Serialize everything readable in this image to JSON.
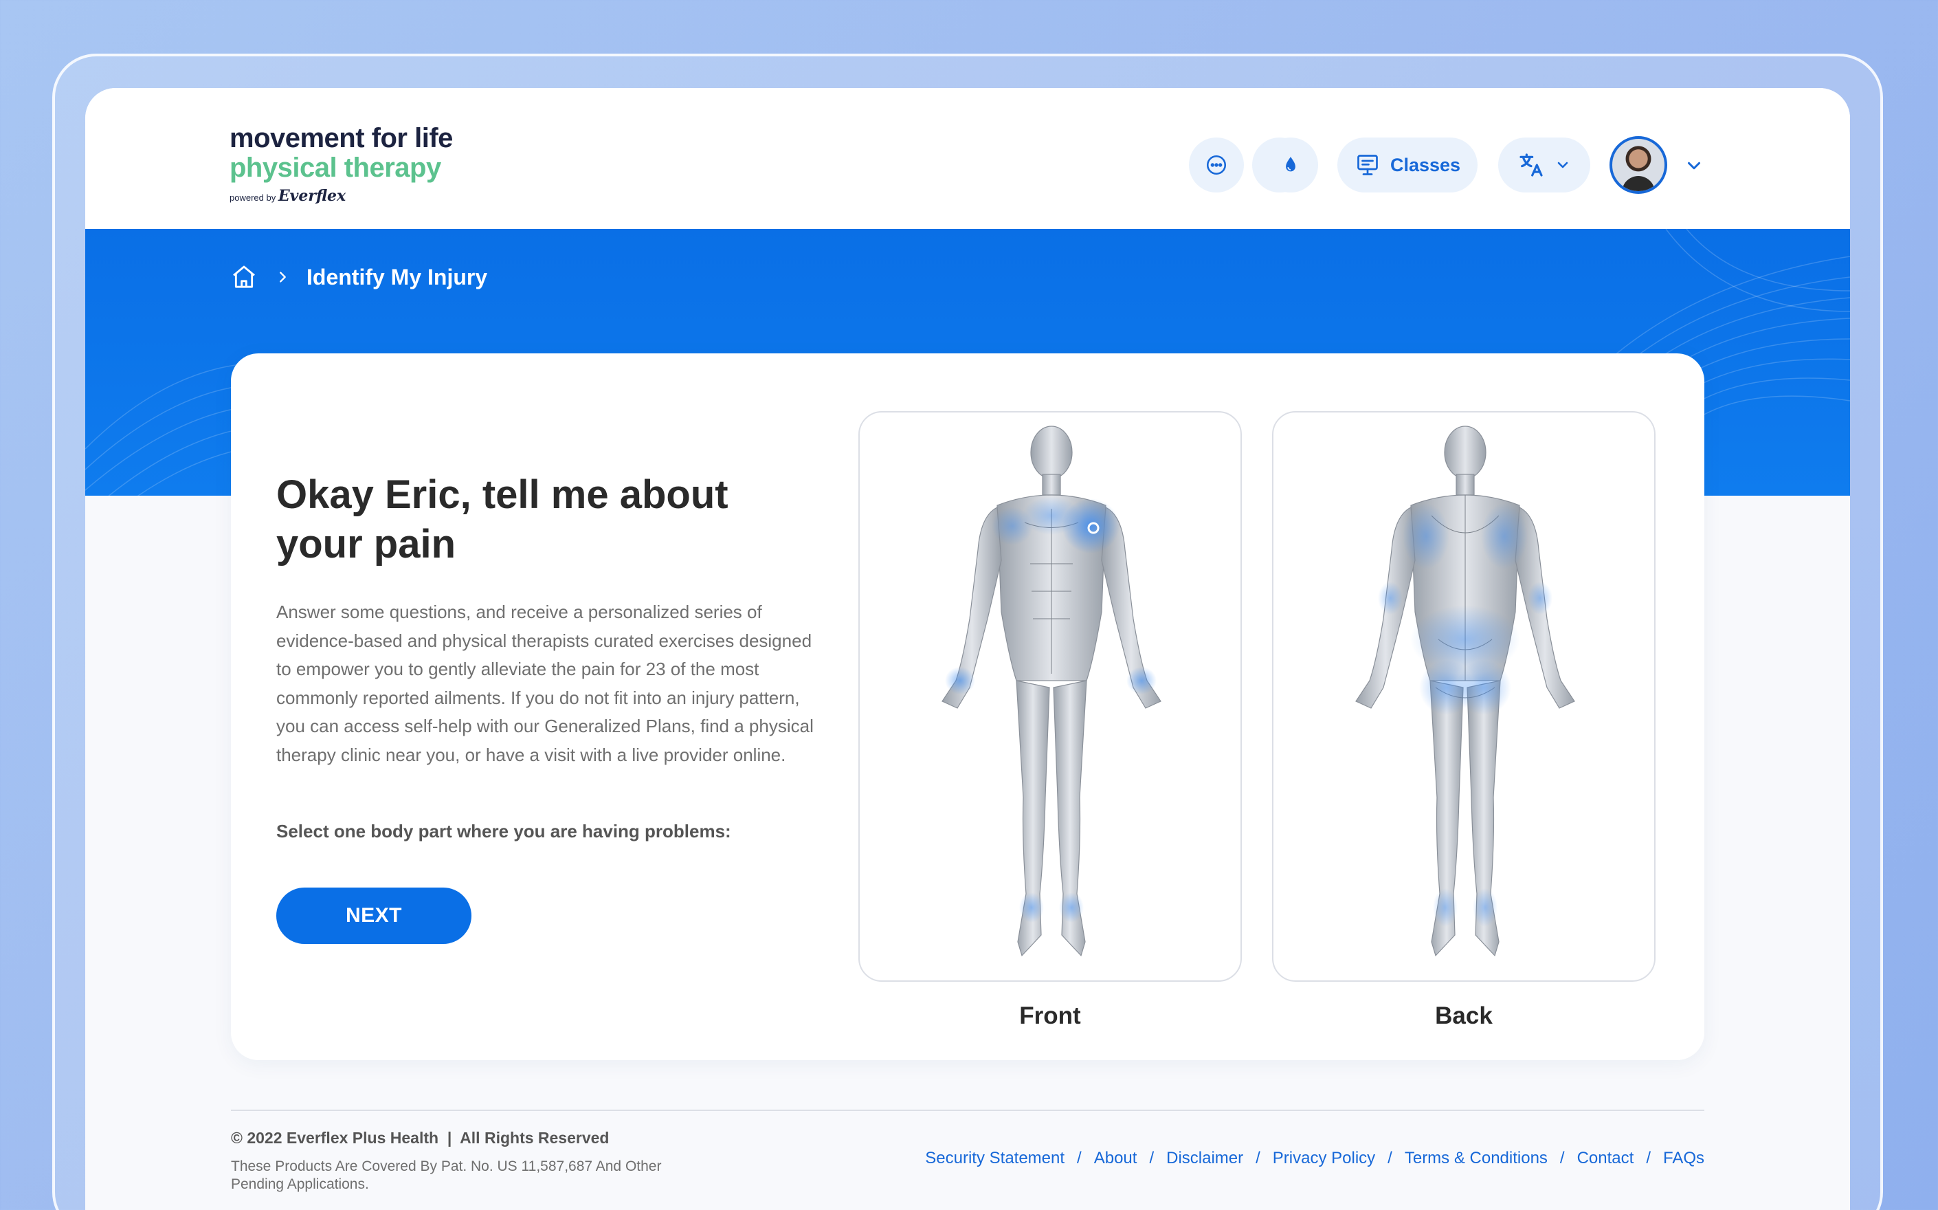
{
  "brand": {
    "line1": "movement for life",
    "line2": "physical therapy",
    "powered_by": "powered by",
    "powered_brand": "Everflex"
  },
  "header": {
    "classes_label": "Classes",
    "icons": [
      "bell-icon",
      "chat-icon",
      "drop-icon",
      "classes-icon",
      "translate-icon",
      "chevron-down-icon"
    ]
  },
  "breadcrumb": {
    "home_icon": "home-icon",
    "current": "Identify My Injury"
  },
  "main": {
    "title": "Okay Eric, tell me about your pain",
    "description": "Answer some questions, and receive a personalized series of evidence-based and physical therapists curated exercises designed to empower you to gently alleviate the pain for 23 of the most commonly reported ailments. If you do not fit into an injury pattern, you can access self-help with our Generalized Plans, find a physical therapy clinic near you, or have a visit with a live provider online.",
    "select_prompt": "Select one body part where you are having problems:",
    "next_label": "NEXT",
    "front_label": "Front",
    "back_label": "Back"
  },
  "footer": {
    "copyright": "© 2022 Everflex Plus Health  |  All Rights Reserved",
    "patent": "These Products Are Covered By Pat. No. US 11,587,687 And Other Pending Applications.",
    "links": [
      "Security Statement",
      "About",
      "Disclaimer",
      "Privacy Policy",
      "Terms & Conditions",
      "Contact",
      "FAQs"
    ]
  },
  "colors": {
    "primary": "#0a6fe6",
    "accent_green": "#5cc28e",
    "dark_text": "#2a2a2a"
  }
}
